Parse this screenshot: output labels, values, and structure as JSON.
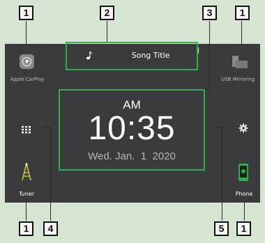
{
  "callouts": {
    "c1a": "1",
    "c2": "2",
    "c3": "3",
    "c1b": "1",
    "c1c": "1",
    "c4": "4",
    "c5": "5",
    "c1d": "1"
  },
  "now_playing": {
    "song_title": "Song Title",
    "note_icon": "music-note-icon"
  },
  "clock": {
    "ampm": "AM",
    "time": "10:35",
    "date": "Wed. Jan.  1  2020"
  },
  "shortcuts": {
    "top_left": {
      "label": "Apple CarPlay",
      "icon": "carplay-icon"
    },
    "top_right": {
      "label": "USB Mirroring",
      "icon": "usb-mirroring-icon"
    },
    "bottom_left": {
      "label": "Tuner",
      "icon": "tuner-icon"
    },
    "bottom_right": {
      "label": "Phone",
      "icon": "phone-icon"
    }
  },
  "controls": {
    "menu_icon": "grid-menu-icon",
    "settings_icon": "gear-icon"
  },
  "colors": {
    "highlight": "#2bb04d",
    "screen": "#3a3b3d",
    "background": "#d5e5d2"
  }
}
